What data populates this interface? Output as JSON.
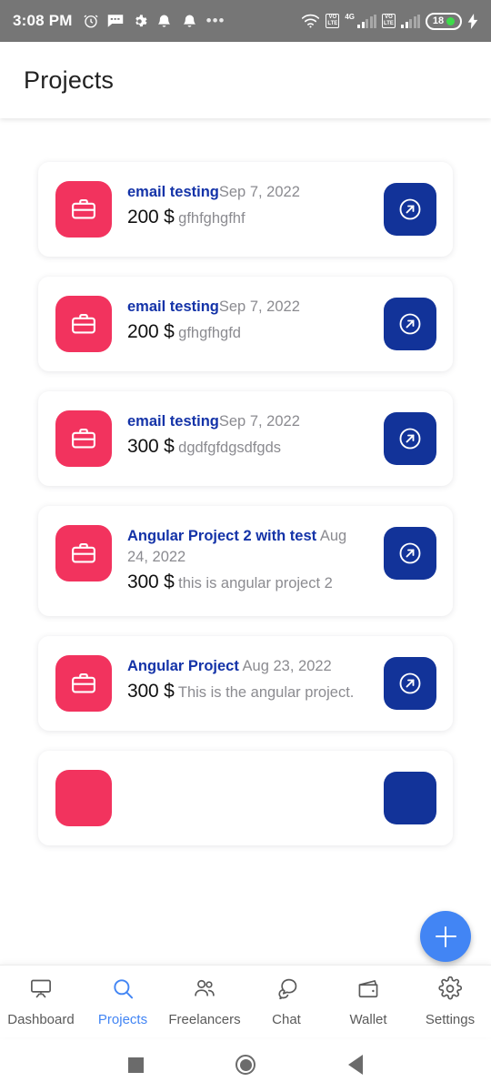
{
  "status_bar": {
    "time": "3:08 PM",
    "battery_level": "18",
    "network_label": "4G",
    "volte_line1": "VO",
    "volte_line2": "LTE",
    "icons": [
      "alarm-clock-icon",
      "message-icon",
      "gear-icon",
      "bell-icon",
      "bell-icon",
      "overflow-dots-icon",
      "wifi-icon",
      "volte-icon",
      "signal-bars-icon",
      "volte-icon",
      "signal-bars-icon",
      "battery-icon",
      "charging-bolt-icon"
    ]
  },
  "header": {
    "title": "Projects"
  },
  "projects": [
    {
      "title": "email testing",
      "date": "Sep 7, 2022",
      "amount": "200 $",
      "description": "gfhfghgfhf"
    },
    {
      "title": "email testing",
      "date": "Sep 7, 2022",
      "amount": "200 $",
      "description": "gfhgfhgfd"
    },
    {
      "title": "email testing",
      "date": "Sep 7, 2022",
      "amount": "300 $",
      "description": "dgdfgfdgsdfgds"
    },
    {
      "title": "Angular Project 2 with test",
      "date": "Aug 24, 2022",
      "amount": "300 $",
      "description": "this is angular project 2"
    },
    {
      "title": "Angular Project",
      "date": "Aug 23, 2022",
      "amount": "300 $",
      "description": "This is the angular project."
    }
  ],
  "fab": {
    "label": "+",
    "icon": "plus-icon"
  },
  "bottom_nav": {
    "items": [
      {
        "label": "Dashboard",
        "icon": "dashboard-icon",
        "active": false
      },
      {
        "label": "Projects",
        "icon": "search-icon",
        "active": true
      },
      {
        "label": "Freelancers",
        "icon": "people-icon",
        "active": false
      },
      {
        "label": "Chat",
        "icon": "chat-bubble-icon",
        "active": false
      },
      {
        "label": "Wallet",
        "icon": "wallet-icon",
        "active": false
      },
      {
        "label": "Settings",
        "icon": "gear-icon",
        "active": false
      }
    ]
  },
  "android_nav": {
    "recents": "recents-button",
    "home": "home-button",
    "back": "back-button"
  },
  "colors": {
    "tile": "#f2335e",
    "action_button": "#123399",
    "title": "#1433a8",
    "fab": "#4285f4",
    "active_nav": "#4285f4",
    "status_bar": "#767676",
    "muted_text": "#8b8b90"
  }
}
